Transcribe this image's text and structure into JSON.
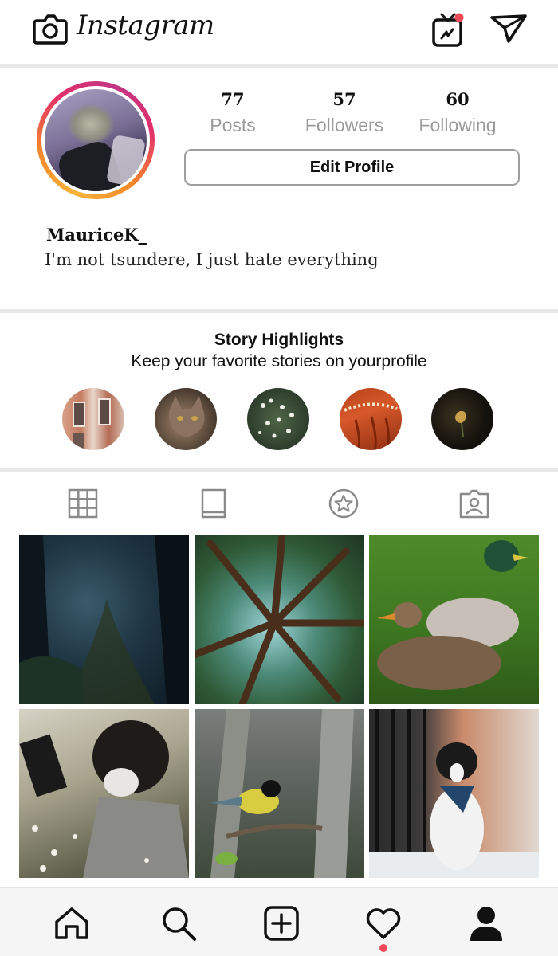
{
  "header": {
    "brand": "Instagram",
    "icons": [
      "camera-icon",
      "igtv-icon",
      "direct-send-icon"
    ],
    "notification_color": "#ed4956"
  },
  "profile": {
    "stats": [
      {
        "value": "77",
        "label": "Posts"
      },
      {
        "value": "57",
        "label": "Followers"
      },
      {
        "value": "60",
        "label": "Following"
      }
    ],
    "edit_button": "Edit Profile",
    "username": "MauriceK_",
    "bio": "I'm not tsundere, I just hate everything",
    "ring_colors": [
      "#f6b43b",
      "#f58529",
      "#e1306c",
      "#c13584"
    ]
  },
  "highlights": {
    "title": "Story Highlights",
    "subtitle": "Keep your favorite stories on yourprofile",
    "items": [
      "highlight-brick-building",
      "highlight-cat",
      "highlight-white-flowers",
      "highlight-red-hair",
      "highlight-dark-flower"
    ]
  },
  "tabs": [
    "grid-icon",
    "igtv-tab-icon",
    "saved-star-icon",
    "tagged-icon"
  ],
  "posts": [
    "post-dark-forest",
    "post-tree-canopy",
    "post-mallard-ducks",
    "post-reading-in-flowers",
    "post-great-tit-bird",
    "post-border-collie"
  ],
  "bottom_nav": [
    "home-icon",
    "search-icon",
    "new-post-icon",
    "activity-heart-icon",
    "profile-icon"
  ]
}
